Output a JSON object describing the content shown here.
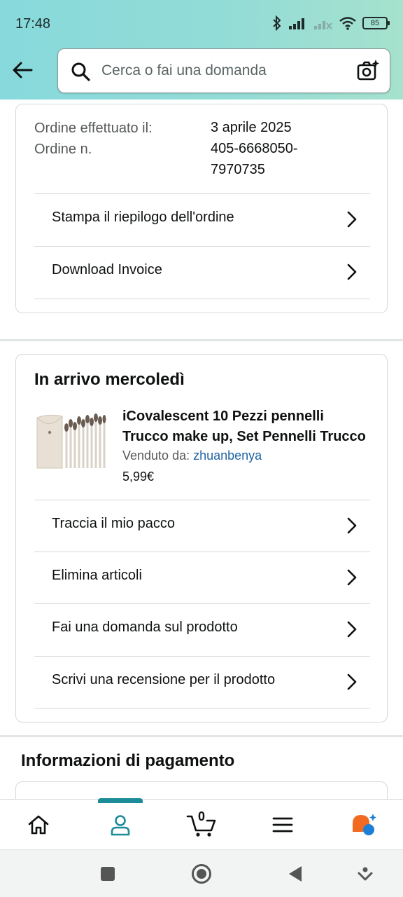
{
  "status_bar": {
    "time": "17:48",
    "battery": "85"
  },
  "search": {
    "placeholder": "Cerca o fai una domanda"
  },
  "order_info": {
    "placed_label": "Ordine effettuato il:",
    "placed_value": "3 aprile 2025",
    "number_label": "Ordine n.",
    "number_value_line1": "405-6668050-",
    "number_value_line2": "7970735",
    "actions": [
      "Stampa il riepilogo dell'ordine",
      "Download Invoice"
    ]
  },
  "shipment": {
    "title": "In arrivo mercoledì",
    "product_name_line1": "iCovalescent 10 Pezzi pennelli",
    "product_name_line2": "Trucco make up, Set Pennelli Trucco",
    "sold_by_label": "Venduto da:",
    "seller": "zhuanbenya",
    "price": "5,99€",
    "actions": [
      "Traccia il mio pacco",
      "Elimina articoli",
      "Fai una domanda sul prodotto",
      "Scrivi una recensione per il prodotto"
    ]
  },
  "payment": {
    "title": "Informazioni di pagamento"
  },
  "bottom_nav": {
    "cart_count": "0",
    "active": "account"
  },
  "colors": {
    "accent": "#1c8c99",
    "link": "#2162a1",
    "header_gradient_start": "#87d9dc",
    "header_gradient_end": "#a6e2cd"
  }
}
